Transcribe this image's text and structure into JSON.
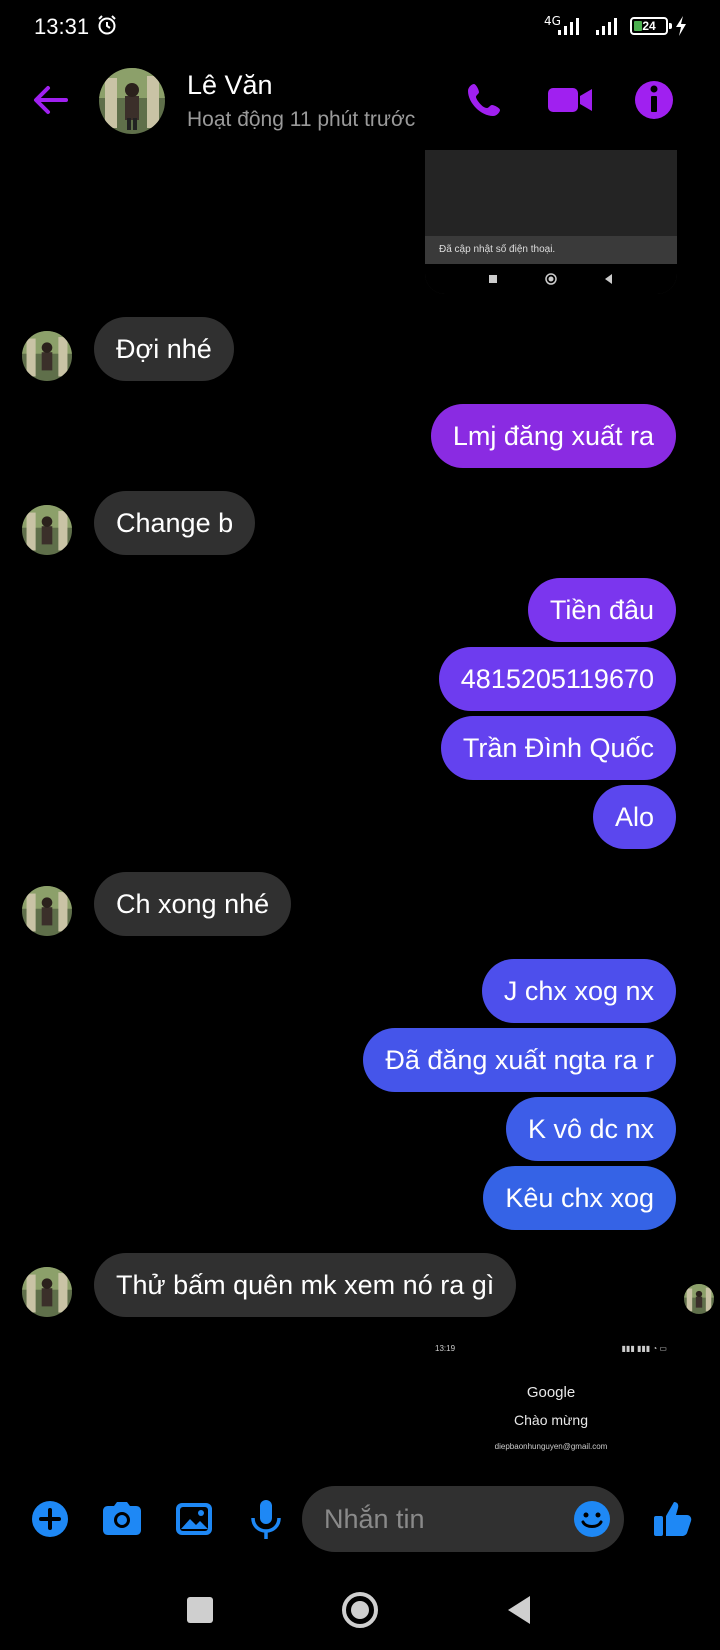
{
  "status_bar": {
    "time": "13:31",
    "network": "4G",
    "battery_level": "24"
  },
  "header": {
    "contact_name": "Lê Văn",
    "activity_status": "Hoạt động 11 phút trước"
  },
  "attachments": {
    "top_screenshot_toast": "Đã cập nhật số điện thoại.",
    "bottom_screenshot": {
      "time": "13:19",
      "brand": "Google",
      "welcome": "Chào mừng",
      "account": "diepbaonhunguyen@gmail.com"
    }
  },
  "messages": [
    {
      "dir": "in",
      "text": "Đợi nhé"
    },
    {
      "dir": "out",
      "text": "Lmj đăng xuất ra",
      "color": "#8a2be2"
    },
    {
      "dir": "in",
      "text": "Change b"
    },
    {
      "dir": "out",
      "text": "Tiền đâu",
      "color": "#7b36ee"
    },
    {
      "dir": "out",
      "text": "4815205119670",
      "color": "#6e3cef"
    },
    {
      "dir": "out",
      "text": "Trần Đình Quốc",
      "color": "#6342ef"
    },
    {
      "dir": "out",
      "text": "Alo",
      "color": "#5b47ee"
    },
    {
      "dir": "in",
      "text": "Ch xong nhé"
    },
    {
      "dir": "out",
      "text": "J chx xog nx",
      "color": "#4d4fec"
    },
    {
      "dir": "out",
      "text": "Đã đăng xuất ngta ra r",
      "color": "#4555ea"
    },
    {
      "dir": "out",
      "text": "K vô dc nx",
      "color": "#3d5de8"
    },
    {
      "dir": "out",
      "text": "Kêu chx xog",
      "color": "#3563e6"
    },
    {
      "dir": "in",
      "text": "Thử bấm quên mk xem nó ra gì"
    }
  ],
  "composer": {
    "placeholder": "Nhắn tin"
  },
  "colors": {
    "accent": "#a020f0",
    "composer_blue": "#1e88f5",
    "incoming_bubble": "#303030"
  },
  "icons": {
    "back": "arrow-left-icon",
    "call": "phone-icon",
    "video": "video-camera-icon",
    "info": "info-icon",
    "add": "plus-circle-icon",
    "camera": "camera-icon",
    "gallery": "image-icon",
    "mic": "microphone-icon",
    "emoji": "smiley-icon",
    "like": "thumbs-up-icon"
  }
}
